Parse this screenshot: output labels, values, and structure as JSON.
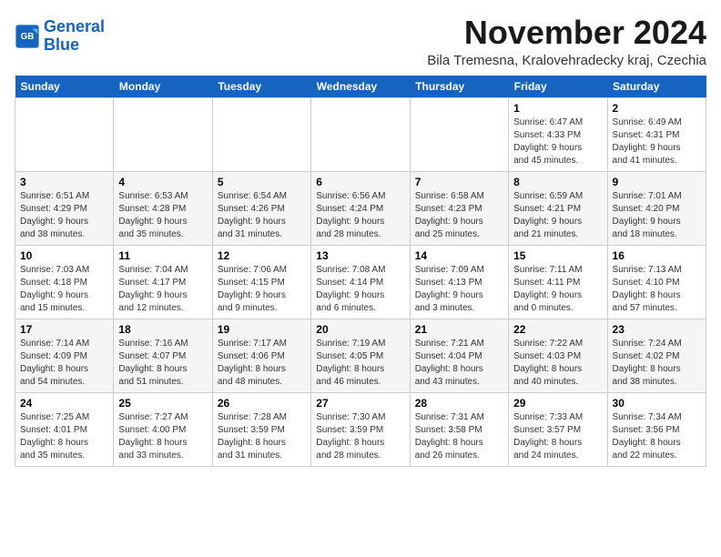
{
  "logo": {
    "line1": "General",
    "line2": "Blue"
  },
  "title": "November 2024",
  "subtitle": "Bila Tremesna, Kralovehradecky kraj, Czechia",
  "weekdays": [
    "Sunday",
    "Monday",
    "Tuesday",
    "Wednesday",
    "Thursday",
    "Friday",
    "Saturday"
  ],
  "weeks": [
    [
      {
        "day": "",
        "info": ""
      },
      {
        "day": "",
        "info": ""
      },
      {
        "day": "",
        "info": ""
      },
      {
        "day": "",
        "info": ""
      },
      {
        "day": "",
        "info": ""
      },
      {
        "day": "1",
        "info": "Sunrise: 6:47 AM\nSunset: 4:33 PM\nDaylight: 9 hours\nand 45 minutes."
      },
      {
        "day": "2",
        "info": "Sunrise: 6:49 AM\nSunset: 4:31 PM\nDaylight: 9 hours\nand 41 minutes."
      }
    ],
    [
      {
        "day": "3",
        "info": "Sunrise: 6:51 AM\nSunset: 4:29 PM\nDaylight: 9 hours\nand 38 minutes."
      },
      {
        "day": "4",
        "info": "Sunrise: 6:53 AM\nSunset: 4:28 PM\nDaylight: 9 hours\nand 35 minutes."
      },
      {
        "day": "5",
        "info": "Sunrise: 6:54 AM\nSunset: 4:26 PM\nDaylight: 9 hours\nand 31 minutes."
      },
      {
        "day": "6",
        "info": "Sunrise: 6:56 AM\nSunset: 4:24 PM\nDaylight: 9 hours\nand 28 minutes."
      },
      {
        "day": "7",
        "info": "Sunrise: 6:58 AM\nSunset: 4:23 PM\nDaylight: 9 hours\nand 25 minutes."
      },
      {
        "day": "8",
        "info": "Sunrise: 6:59 AM\nSunset: 4:21 PM\nDaylight: 9 hours\nand 21 minutes."
      },
      {
        "day": "9",
        "info": "Sunrise: 7:01 AM\nSunset: 4:20 PM\nDaylight: 9 hours\nand 18 minutes."
      }
    ],
    [
      {
        "day": "10",
        "info": "Sunrise: 7:03 AM\nSunset: 4:18 PM\nDaylight: 9 hours\nand 15 minutes."
      },
      {
        "day": "11",
        "info": "Sunrise: 7:04 AM\nSunset: 4:17 PM\nDaylight: 9 hours\nand 12 minutes."
      },
      {
        "day": "12",
        "info": "Sunrise: 7:06 AM\nSunset: 4:15 PM\nDaylight: 9 hours\nand 9 minutes."
      },
      {
        "day": "13",
        "info": "Sunrise: 7:08 AM\nSunset: 4:14 PM\nDaylight: 9 hours\nand 6 minutes."
      },
      {
        "day": "14",
        "info": "Sunrise: 7:09 AM\nSunset: 4:13 PM\nDaylight: 9 hours\nand 3 minutes."
      },
      {
        "day": "15",
        "info": "Sunrise: 7:11 AM\nSunset: 4:11 PM\nDaylight: 9 hours\nand 0 minutes."
      },
      {
        "day": "16",
        "info": "Sunrise: 7:13 AM\nSunset: 4:10 PM\nDaylight: 8 hours\nand 57 minutes."
      }
    ],
    [
      {
        "day": "17",
        "info": "Sunrise: 7:14 AM\nSunset: 4:09 PM\nDaylight: 8 hours\nand 54 minutes."
      },
      {
        "day": "18",
        "info": "Sunrise: 7:16 AM\nSunset: 4:07 PM\nDaylight: 8 hours\nand 51 minutes."
      },
      {
        "day": "19",
        "info": "Sunrise: 7:17 AM\nSunset: 4:06 PM\nDaylight: 8 hours\nand 48 minutes."
      },
      {
        "day": "20",
        "info": "Sunrise: 7:19 AM\nSunset: 4:05 PM\nDaylight: 8 hours\nand 46 minutes."
      },
      {
        "day": "21",
        "info": "Sunrise: 7:21 AM\nSunset: 4:04 PM\nDaylight: 8 hours\nand 43 minutes."
      },
      {
        "day": "22",
        "info": "Sunrise: 7:22 AM\nSunset: 4:03 PM\nDaylight: 8 hours\nand 40 minutes."
      },
      {
        "day": "23",
        "info": "Sunrise: 7:24 AM\nSunset: 4:02 PM\nDaylight: 8 hours\nand 38 minutes."
      }
    ],
    [
      {
        "day": "24",
        "info": "Sunrise: 7:25 AM\nSunset: 4:01 PM\nDaylight: 8 hours\nand 35 minutes."
      },
      {
        "day": "25",
        "info": "Sunrise: 7:27 AM\nSunset: 4:00 PM\nDaylight: 8 hours\nand 33 minutes."
      },
      {
        "day": "26",
        "info": "Sunrise: 7:28 AM\nSunset: 3:59 PM\nDaylight: 8 hours\nand 31 minutes."
      },
      {
        "day": "27",
        "info": "Sunrise: 7:30 AM\nSunset: 3:59 PM\nDaylight: 8 hours\nand 28 minutes."
      },
      {
        "day": "28",
        "info": "Sunrise: 7:31 AM\nSunset: 3:58 PM\nDaylight: 8 hours\nand 26 minutes."
      },
      {
        "day": "29",
        "info": "Sunrise: 7:33 AM\nSunset: 3:57 PM\nDaylight: 8 hours\nand 24 minutes."
      },
      {
        "day": "30",
        "info": "Sunrise: 7:34 AM\nSunset: 3:56 PM\nDaylight: 8 hours\nand 22 minutes."
      }
    ]
  ]
}
